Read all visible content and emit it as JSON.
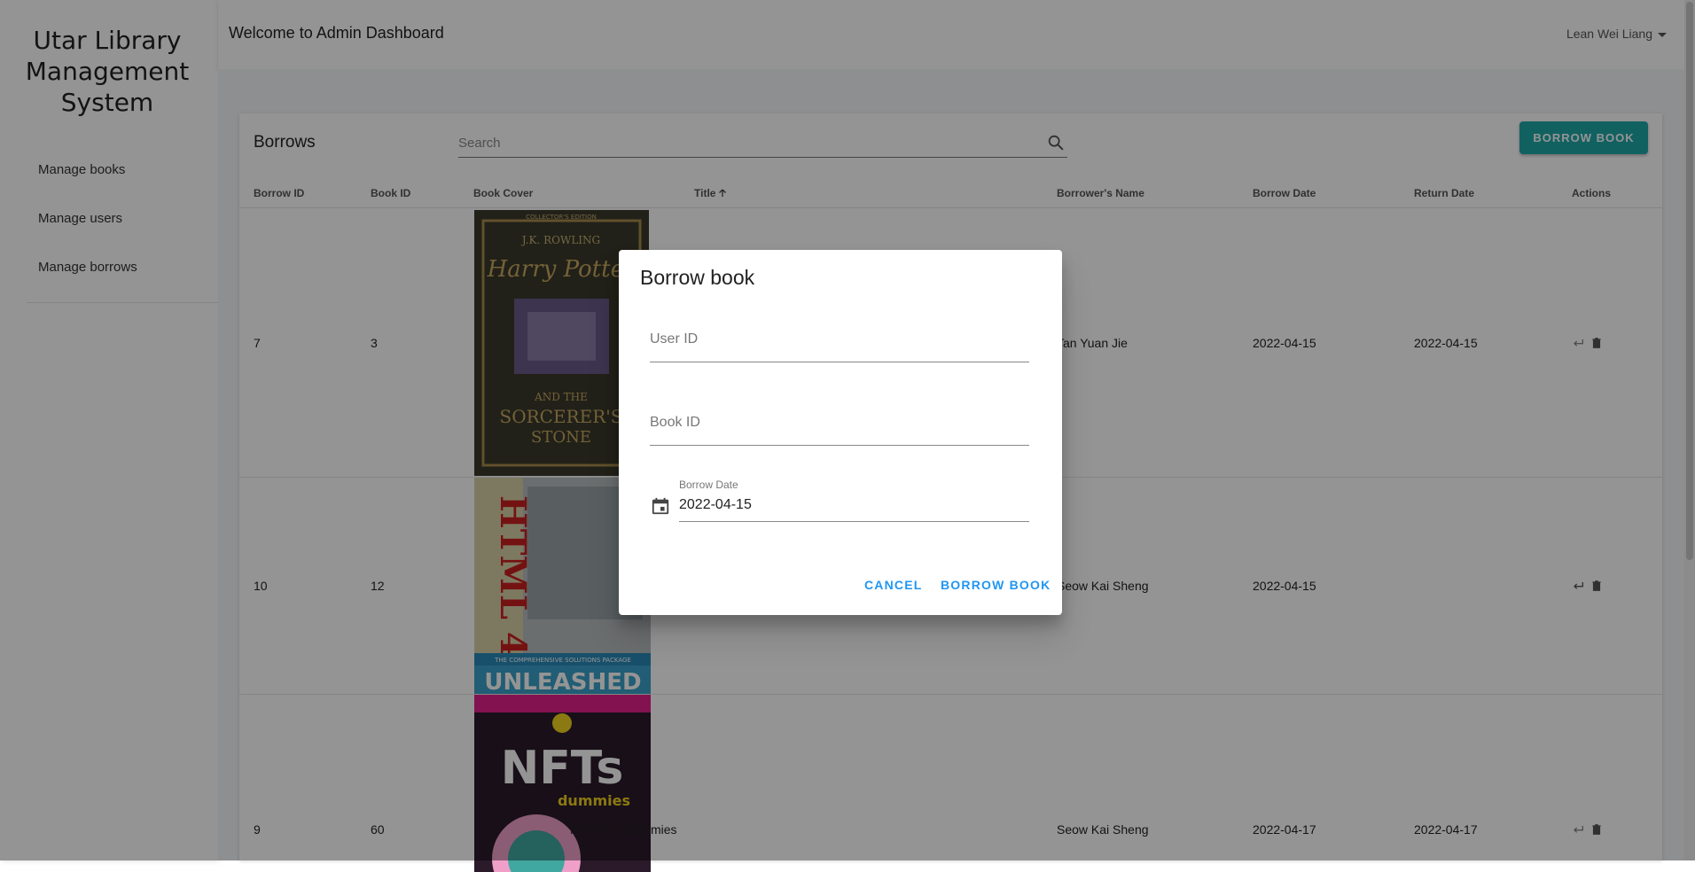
{
  "sidebar": {
    "brand_line1": "Utar Library",
    "brand_line2": "Management",
    "brand_line3": "System",
    "items": [
      {
        "label": "Manage books"
      },
      {
        "label": "Manage users"
      },
      {
        "label": "Manage borrows"
      }
    ]
  },
  "header": {
    "welcome": "Welcome to Admin Dashboard",
    "user": "Lean Wei Liang"
  },
  "borrows": {
    "title": "Borrows",
    "search_placeholder": "Search",
    "borrow_button": "BORROW BOOK",
    "columns": {
      "borrow_id": "Borrow ID",
      "book_id": "Book ID",
      "book_cover": "Book Cover",
      "title": "Title",
      "borrower": "Borrower's Name",
      "borrow_date": "Borrow Date",
      "return_date": "Return Date",
      "actions": "Actions"
    },
    "rows": [
      {
        "borrow_id": "7",
        "book_id": "3",
        "title": "",
        "borrower": "Tan Yuan Jie",
        "borrow_date": "2022-04-15",
        "return_date": "2022-04-15"
      },
      {
        "borrow_id": "10",
        "book_id": "12",
        "title": "",
        "borrower": "Seow Kai Sheng",
        "borrow_date": "2022-04-15",
        "return_date": ""
      },
      {
        "borrow_id": "9",
        "book_id": "60",
        "title": "NFTs For Dummies",
        "borrower": "Seow Kai Sheng",
        "borrow_date": "2022-04-17",
        "return_date": "2022-04-17"
      }
    ]
  },
  "covers": {
    "c1_top": "COLLECTOR'S EDITION",
    "c1_author": "J.K. ROWLING",
    "c1_title": "Harry Potter",
    "c1_sub1": "AND THE",
    "c1_sub2": "SORCERER'S",
    "c1_sub3": "STONE",
    "c2_title": "HTML 4",
    "c2_strip": "THE COMPREHENSIVE SOLUTIONS PACKAGE",
    "c2_bottom": "UNLEASHED",
    "c3_title": "NFTs",
    "c3_sub": "dummies"
  },
  "dialog": {
    "title": "Borrow book",
    "user_id_placeholder": "User ID",
    "book_id_placeholder": "Book ID",
    "borrow_date_label": "Borrow Date",
    "borrow_date_value": "2022-04-15",
    "cancel": "CANCEL",
    "confirm": "BORROW BOOK"
  },
  "colors": {
    "accent": "#20a8a8",
    "dialog_button": "#2196f3"
  }
}
